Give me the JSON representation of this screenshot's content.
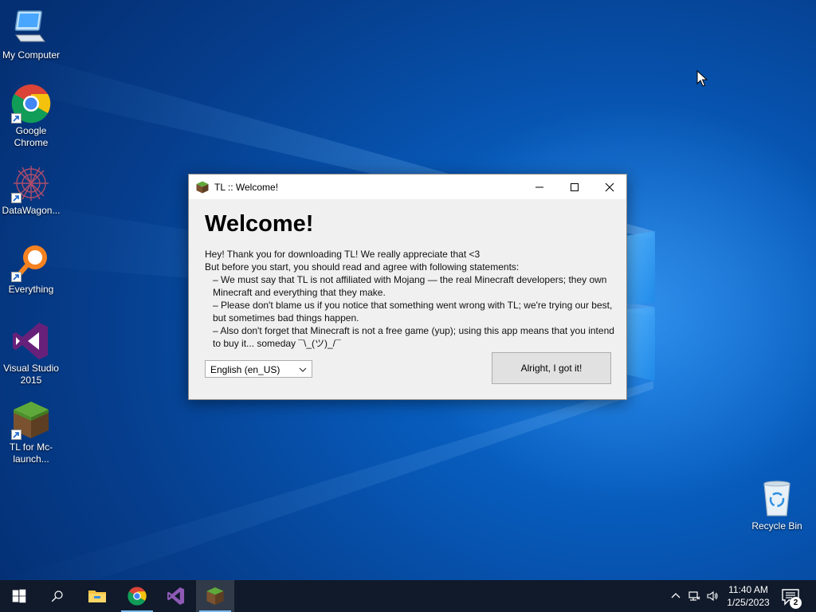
{
  "desktop": {
    "icons": [
      {
        "label": "My Computer",
        "icon": "computer-icon"
      },
      {
        "label": "Google Chrome",
        "icon": "chrome-icon"
      },
      {
        "label": "DataWagon...",
        "icon": "datawagon-icon"
      },
      {
        "label": "Everything",
        "icon": "everything-search-icon"
      },
      {
        "label": "Visual Studio 2015",
        "icon": "visual-studio-icon"
      },
      {
        "label": "TL for Mc-launch...",
        "icon": "minecraft-grass-block-icon"
      },
      {
        "label": "Recycle Bin",
        "icon": "recycle-bin-icon"
      }
    ]
  },
  "dialog": {
    "title": "TL :: Welcome!",
    "heading": "Welcome!",
    "lines": [
      "Hey! Thank you for downloading TL! We really appreciate that <3",
      "But before you start, you should read and agree with following statements:",
      "– We must say that TL is not affiliated with Mojang — the real Minecraft developers; they own Minecraft and everything that they make.",
      "– Please don't blame us if you notice that something went wrong with TL; we're trying our best, but sometimes bad things happen.",
      "– Also don't forget that Minecraft is not a free game (yup); using this app means that you intend to buy it... someday ¯\\_(ツ)_/¯"
    ],
    "language": "English (en_US)",
    "ok_label": "Alright, I got it!"
  },
  "taskbar": {
    "apps": [
      "start-icon",
      "search-icon",
      "file-explorer-icon",
      "chrome-icon",
      "visual-studio-icon",
      "minecraft-grass-block-icon"
    ],
    "time": "11:40 AM",
    "date": "1/25/2023",
    "notification_count": "2"
  },
  "colors": {
    "desktop_blue": "#0759b8",
    "taskbar": "#101a2a",
    "dialog_bg": "#f0f0f0",
    "accent_underline": "#76b9ed"
  }
}
